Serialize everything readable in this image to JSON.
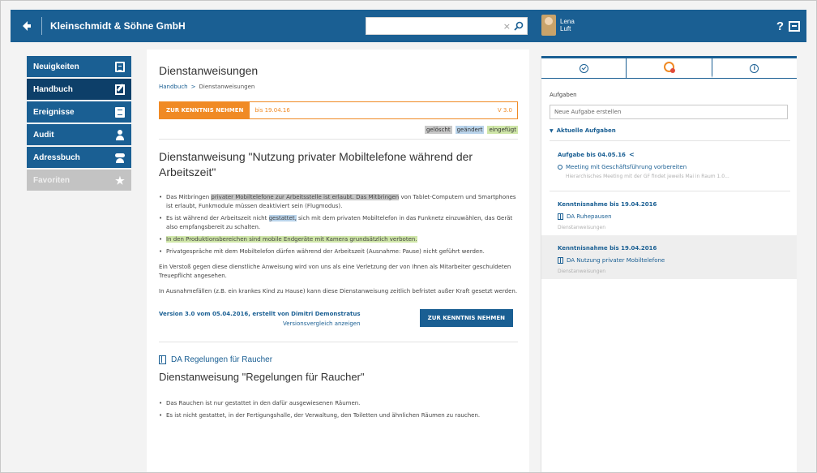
{
  "header": {
    "app_title": "Kleinschmidt & Söhne GmbH",
    "search_placeholder": "",
    "search_clear": "×",
    "user_first": "Lena",
    "user_last": "Luft",
    "help_label": "?"
  },
  "sidebar": {
    "items": [
      {
        "label": "Neuigkeiten"
      },
      {
        "label": "Handbuch"
      },
      {
        "label": "Ereignisse"
      },
      {
        "label": "Audit"
      },
      {
        "label": "Adressbuch"
      },
      {
        "label": "Favoriten"
      }
    ]
  },
  "main": {
    "page_title": "Dienstanweisungen",
    "breadcrumb": {
      "root": "Handbuch",
      "separator": ">",
      "current": "Dienstanweisungen"
    },
    "ack_bar": {
      "button": "ZUR KENNTNIS NEHMEN",
      "date": "bis 19.04.16",
      "version": "V 3.0"
    },
    "legend": {
      "deleted": "gelöscht",
      "changed": "geändert",
      "added": "eingefügt"
    },
    "doc_title": "Dienstanweisung \"Nutzung privater Mobiltelefone während der Arbeitszeit\"",
    "bullets": [
      {
        "pre": "Das Mitbringen ",
        "del": "privater Mobiltelefone zur Arbeitsstelle ist erlaubt. Das Mitbringen",
        "post": " von Tablet-Computern und Smartphones ist erlaubt, Funkmodule müssen deaktiviert sein (Flugmodus)."
      },
      {
        "pre": "Es ist während der Arbeitszeit nicht ",
        "chg": "gestattet,",
        "post": " sich mit dem privaten Mobiltelefon in das Funknetz einzuwählen, das Gerät also empfangsbereit zu schalten."
      },
      {
        "add": "In den Produktionsbereichen sind mobile Endgeräte mit Kamera grundsätzlich verboten."
      },
      {
        "text": "Privatgespräche mit dem Mobiltelefon dürfen während der Arbeitszeit (Ausnahme: Pause) nicht geführt werden."
      }
    ],
    "paragraphs": [
      "Ein Verstoß gegen diese dienstliche Anweisung wird von uns als eine Verletzung der von Ihnen als Mitarbeiter geschuldeten Treuepflicht angesehen.",
      "In Ausnahmefällen (z.B. ein krankes Kind zu Hause) kann diese Dienstanweisung zeitlich befristet außer Kraft gesetzt werden."
    ],
    "version_info": "Version 3.0 vom 05.04.2016, erstellt von Dimitri Demonstratus",
    "version_compare": "Versionsvergleich anzeigen",
    "ack_button": "ZUR KENNTNIS NEHMEN",
    "doc2_link": "DA Regelungen für Raucher",
    "doc2_title": "Dienstanweisung \"Regelungen für Raucher\"",
    "doc2_bullets": [
      "Das Rauchen ist nur gestattet in den dafür ausgewiesenen Räumen.",
      "Es ist nicht gestattet, in der Fertigungshalle, der Verwaltung, den Toiletten und ähnlichen Räumen zu rauchen."
    ]
  },
  "right_panel": {
    "tasks_label": "Aufgaben",
    "new_task_placeholder": "Neue Aufgabe erstellen",
    "section_title": "Aktuelle Aufgaben",
    "tasks": [
      {
        "title": "Aufgabe bis 04.05.16",
        "link": "Meeting mit Geschäftsführung vorbereiten",
        "sub": "Hierarchisches Meeting mit der GF findet jeweils Mai in Raum 1.0..."
      },
      {
        "title": "Kenntnisnahme bis 19.04.2016",
        "link": "DA Ruhepausen",
        "sub": "Dienstanweisungen"
      },
      {
        "title": "Kenntnisnahme bis 19.04.2016",
        "link": "DA Nutzung privater Mobiltelefone",
        "sub": "Dienstanweisungen"
      }
    ]
  },
  "colors": {
    "primary": "#1a5f93",
    "accent": "#f08a24",
    "dark_nav": "#0d3f69"
  },
  "icons": {
    "back": "arrow-left-icon",
    "search": "search-icon",
    "help": "help-icon",
    "logout": "logout-icon"
  }
}
